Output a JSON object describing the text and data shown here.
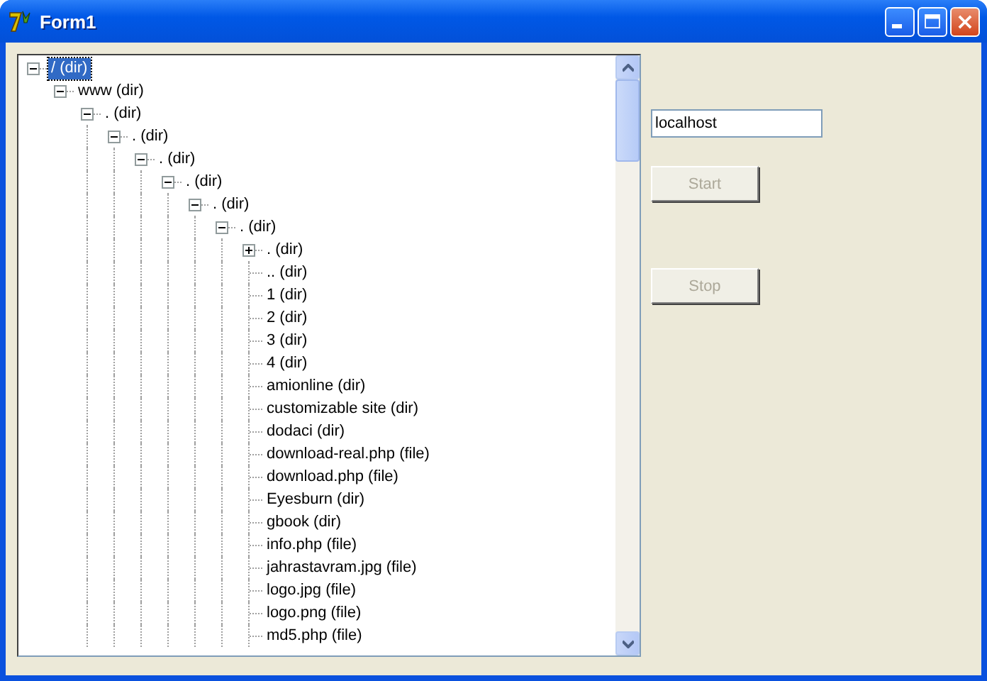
{
  "window": {
    "title": "Form1"
  },
  "tree": [
    {
      "label": "/ (dir)",
      "selected": true,
      "expanded": true,
      "children": [
        {
          "label": "www (dir)",
          "selected": false,
          "expanded": true,
          "children": [
            {
              "label": ". (dir)",
              "selected": false,
              "expanded": true,
              "children": [
                {
                  "label": ". (dir)",
                  "selected": false,
                  "expanded": true,
                  "children": [
                    {
                      "label": ". (dir)",
                      "selected": false,
                      "expanded": true,
                      "children": [
                        {
                          "label": ". (dir)",
                          "selected": false,
                          "expanded": true,
                          "children": [
                            {
                              "label": ". (dir)",
                              "selected": false,
                              "expanded": true,
                              "children": [
                                {
                                  "label": ". (dir)",
                                  "selected": false,
                                  "expanded": true,
                                  "children": [
                                    {
                                      "label": ". (dir)",
                                      "selected": false,
                                      "expanded": false
                                    },
                                    {
                                      "label": ".. (dir)",
                                      "selected": false
                                    },
                                    {
                                      "label": "1 (dir)",
                                      "selected": false
                                    },
                                    {
                                      "label": "2 (dir)",
                                      "selected": false
                                    },
                                    {
                                      "label": "3 (dir)",
                                      "selected": false
                                    },
                                    {
                                      "label": "4 (dir)",
                                      "selected": false
                                    },
                                    {
                                      "label": "amionline (dir)",
                                      "selected": false
                                    },
                                    {
                                      "label": "customizable site (dir)",
                                      "selected": false
                                    },
                                    {
                                      "label": "dodaci (dir)",
                                      "selected": false
                                    },
                                    {
                                      "label": "download-real.php (file)",
                                      "selected": false
                                    },
                                    {
                                      "label": "download.php (file)",
                                      "selected": false
                                    },
                                    {
                                      "label": "Eyesburn (dir)",
                                      "selected": false
                                    },
                                    {
                                      "label": "gbook (dir)",
                                      "selected": false
                                    },
                                    {
                                      "label": "info.php (file)",
                                      "selected": false
                                    },
                                    {
                                      "label": "jahrastavram.jpg (file)",
                                      "selected": false
                                    },
                                    {
                                      "label": "logo.jpg (file)",
                                      "selected": false
                                    },
                                    {
                                      "label": "logo.png (file)",
                                      "selected": false
                                    },
                                    {
                                      "label": "md5.php (file)",
                                      "selected": false
                                    }
                                  ]
                                }
                              ]
                            }
                          ]
                        }
                      ]
                    }
                  ]
                }
              ]
            }
          ]
        }
      ]
    }
  ],
  "host_field": {
    "value": "localhost"
  },
  "buttons": [
    {
      "label": "Start",
      "disabled": true
    },
    {
      "label": "Stop",
      "disabled": true
    }
  ]
}
